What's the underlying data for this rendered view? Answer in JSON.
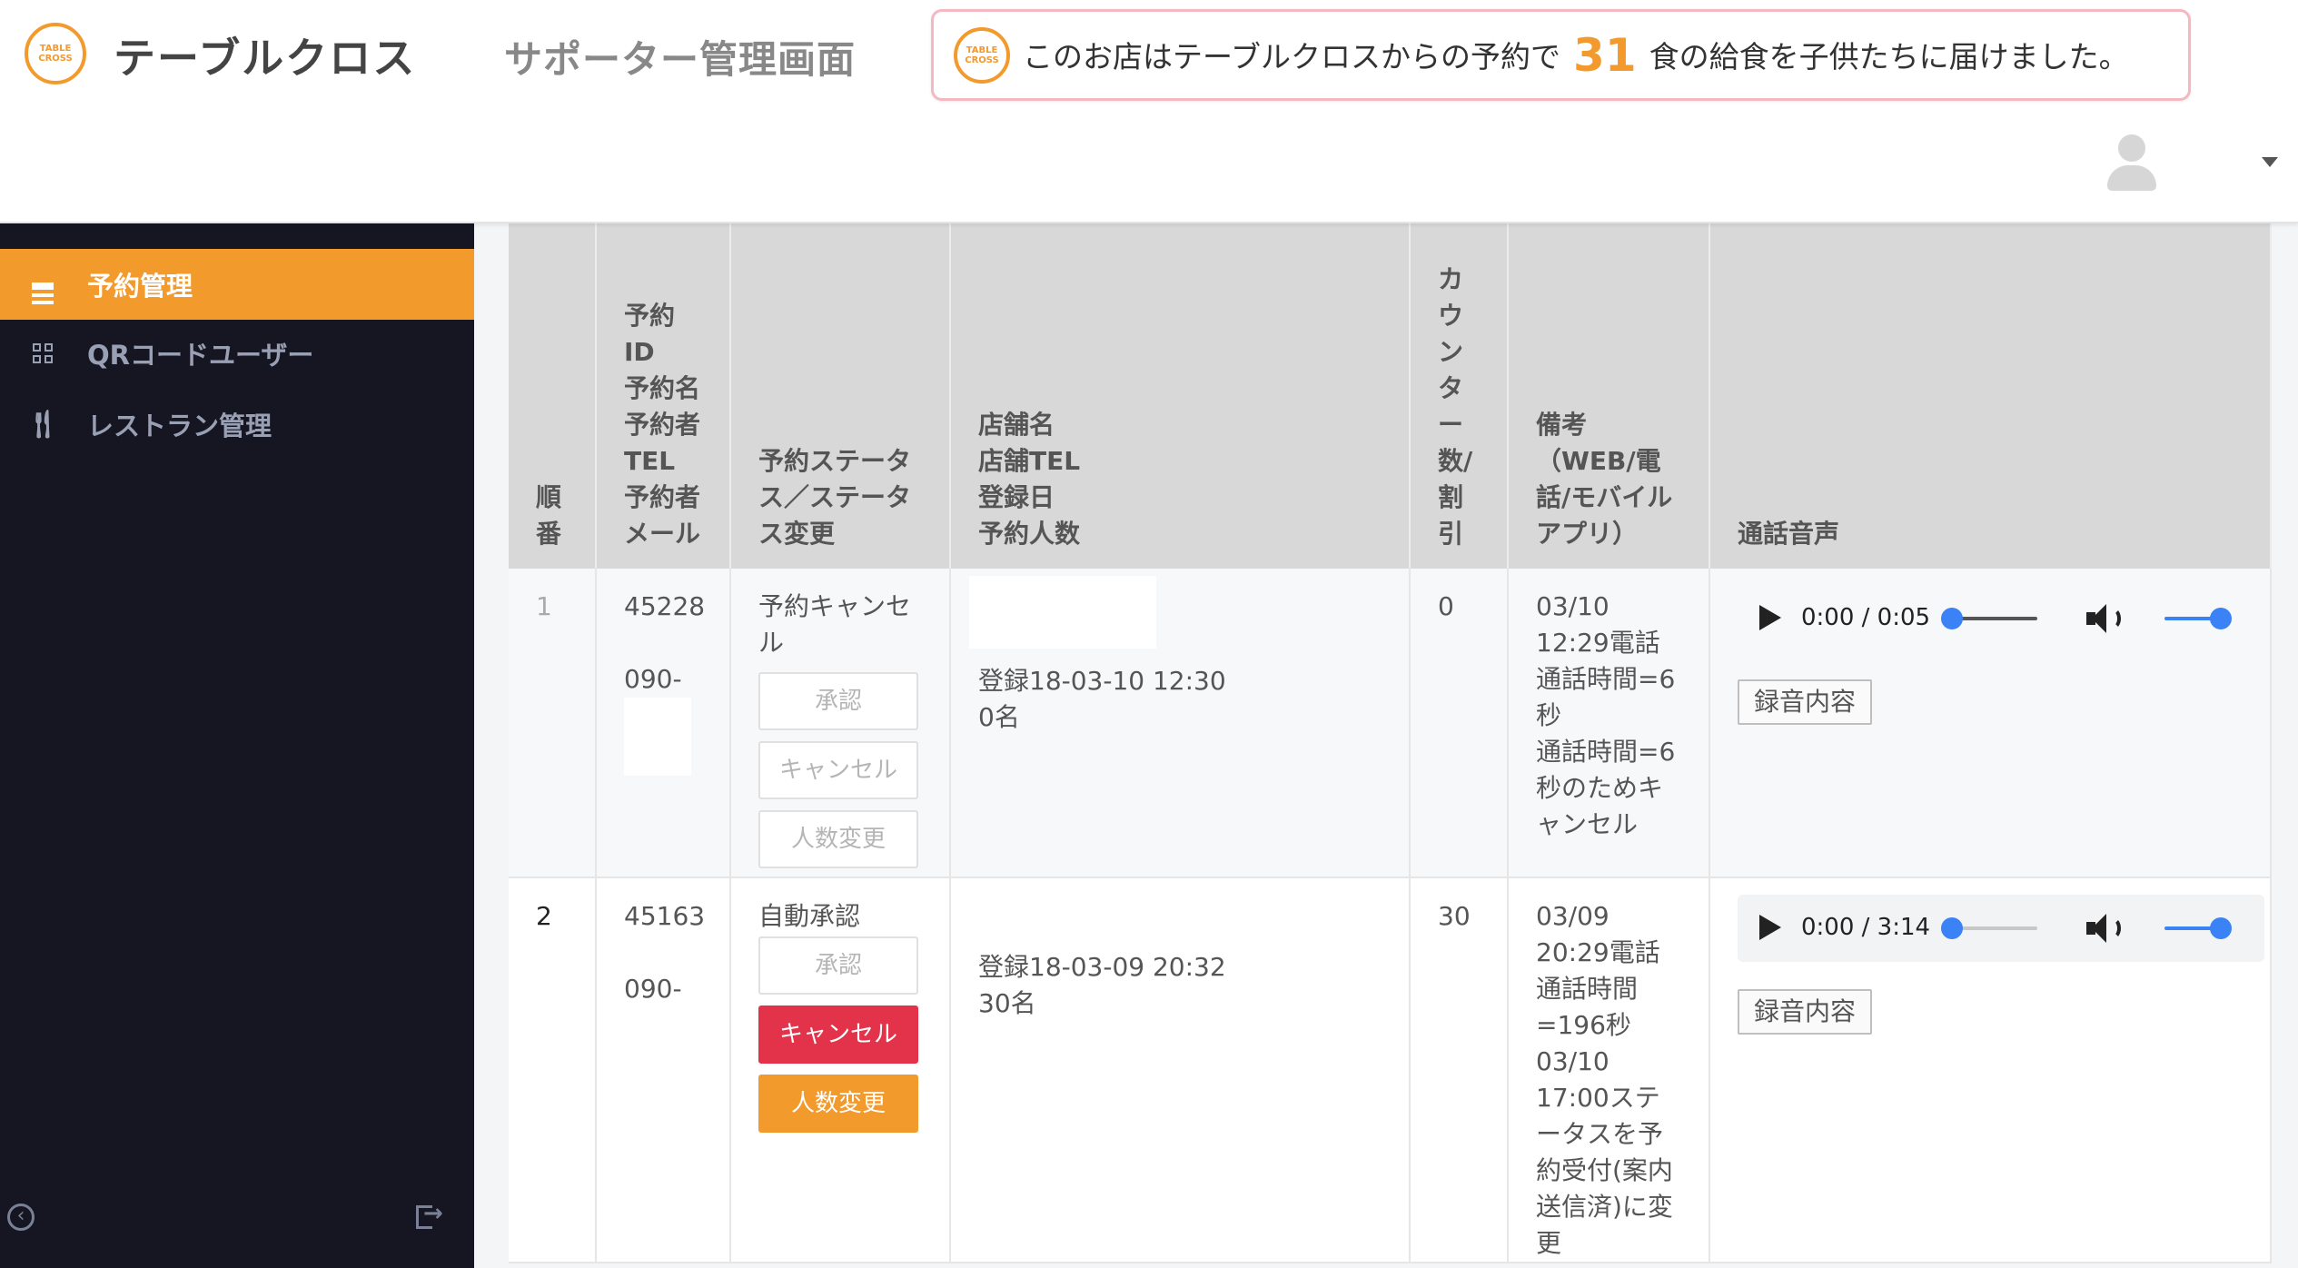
{
  "header": {
    "logo_text": "TABLE CROSS",
    "brand": "テーブルクロス",
    "subtitle": "サポーター管理画面",
    "notice": {
      "prefix": "このお店はテーブルクロスからの予約で",
      "count": "31",
      "suffix": "食の給食を子供たちに届けました。"
    },
    "avatar_icon": "user-avatar-icon",
    "menu_icon": "caret-down-icon"
  },
  "sidebar": {
    "items": [
      {
        "label": "予約管理",
        "icon": "hamburger-icon",
        "active": true
      },
      {
        "label": "QRコードユーザー",
        "icon": "qr-code-icon",
        "active": false
      },
      {
        "label": "レストラン管理",
        "icon": "utensils-icon",
        "active": false
      }
    ],
    "collapse_icon": "chevron-left-circle-icon",
    "logout_icon": "logout-icon"
  },
  "table": {
    "headers": {
      "order": "順番",
      "reservation": "予約ID\n予約名\n予約者TEL\n予約者メール",
      "status": "予約ステータス／ステータス変更",
      "store": "店舗名\n店舗TEL\n登録日\n予約人数",
      "counter": "カウンター数/割引",
      "remarks": "備考（WEB/電話/モバイルアプリ）",
      "audio": "通話音声"
    },
    "rows": [
      {
        "order": "1",
        "reservation_id": "45228",
        "phone": "090-",
        "status": "予約キャンセル",
        "buttons": {
          "approve": "承認",
          "cancel": "キャンセル",
          "change": "人数変更"
        },
        "registered": "登録18-03-10 12:30",
        "people": "0名",
        "counter": "0",
        "remarks": "03/10\n12:29電話\n通話時間=6秒\n通話時間=6秒のためキャンセル",
        "audio_time": "0:00 / 0:05",
        "record_label": "録音内容"
      },
      {
        "order": "2",
        "reservation_id": "45163",
        "phone": "090-",
        "status": "自動承認",
        "buttons": {
          "approve": "承認",
          "cancel": "キャンセル",
          "change": "人数変更"
        },
        "registered": "登録18-03-09 20:32",
        "people": "30名",
        "counter": "30",
        "remarks": "03/09\n20:29電話\n通話時間\n=196秒\n03/10\n17:00ステータスを予約受付(案内送信済)に変更",
        "audio_time": "0:00 / 3:14",
        "record_label": "録音内容"
      }
    ]
  },
  "colors": {
    "accent": "#f39a2c",
    "sidebar_bg": "#151622",
    "danger": "#e2334b",
    "notice_border": "#f4b8c0",
    "audio_knob": "#3b82f6"
  }
}
